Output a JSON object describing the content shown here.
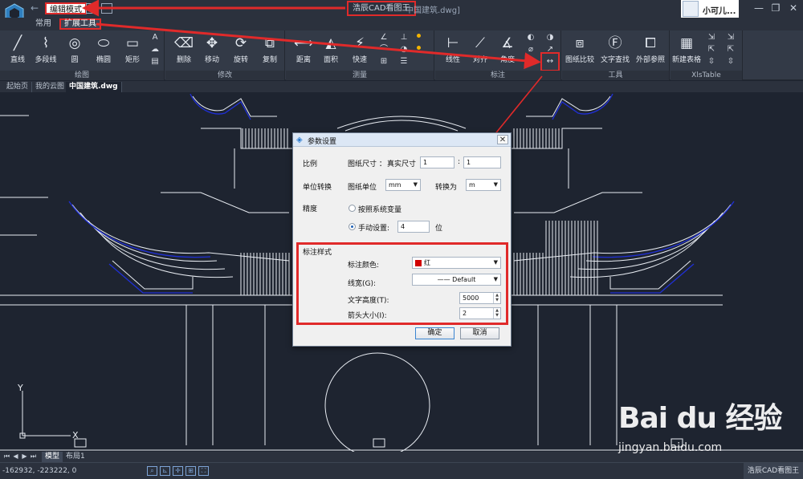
{
  "titlebar": {
    "mode_label": "编辑模式",
    "app_name": "浩辰CAD看图王",
    "file_name": "中国建筑.dwg]",
    "user_name": "小可儿..."
  },
  "ribbon": {
    "tabs": [
      {
        "label": "常用"
      },
      {
        "label": "扩展工具"
      }
    ],
    "groups": {
      "draw": {
        "title": "绘图",
        "tools": [
          "直线",
          "多段线",
          "圆",
          "椭圆",
          "矩形"
        ]
      },
      "modify": {
        "title": "修改",
        "tools": [
          "删除",
          "移动",
          "旋转",
          "复制"
        ]
      },
      "measure": {
        "title": "测量",
        "tools": [
          "距离",
          "面积",
          "快速"
        ]
      },
      "annotate": {
        "title": "标注",
        "tools": [
          "线性",
          "对齐",
          "角度"
        ]
      },
      "tools": {
        "title": "工具",
        "tools": [
          "图纸比较",
          "文字查找",
          "外部参照"
        ]
      },
      "xlstable": {
        "title": "XlsTable",
        "tools": [
          "新建表格"
        ]
      }
    }
  },
  "doc_tabs": [
    "起始页",
    "我的云图",
    "中国建筑.dwg"
  ],
  "dialog": {
    "title": "参数设置",
    "scale_label": "比例",
    "paper_size_label": "图纸尺寸 ：",
    "real_size_label": "真实尺寸",
    "paper_value": "1",
    "colon": ":",
    "real_value": "1",
    "unit_label": "单位转换",
    "paper_unit_label": "图纸单位",
    "paper_unit_value": "mm",
    "convert_label": "转换为",
    "convert_value": "m",
    "precision_label": "精度",
    "precision_system_label": "按照系统变量",
    "precision_manual_label": "手动设置:",
    "precision_manual_value": "4",
    "precision_unit": "位",
    "style_section_label": "标注样式",
    "color_label": "标注颜色:",
    "color_value": "红",
    "color_hex": "#d10000",
    "lineweight_label": "线宽(G):",
    "lineweight_value": "Default",
    "text_height_label": "文字高度(T):",
    "text_height_value": "5000",
    "arrow_size_label": "箭头大小(I):",
    "arrow_size_value": "2",
    "ok_label": "确定",
    "cancel_label": "取消"
  },
  "layout_tabs": [
    "模型",
    "布局1"
  ],
  "status": {
    "coords": "-162932, -223222, 0",
    "brand": "浩辰CAD看图王"
  },
  "watermark": {
    "logo": "Bai du 经验",
    "url": "jingyan.baidu.com"
  },
  "colors": {
    "highlight": "#e02a2a",
    "canvas": "#1e2430",
    "ribbon": "#333a47",
    "accent_dot": "#f4b400"
  }
}
